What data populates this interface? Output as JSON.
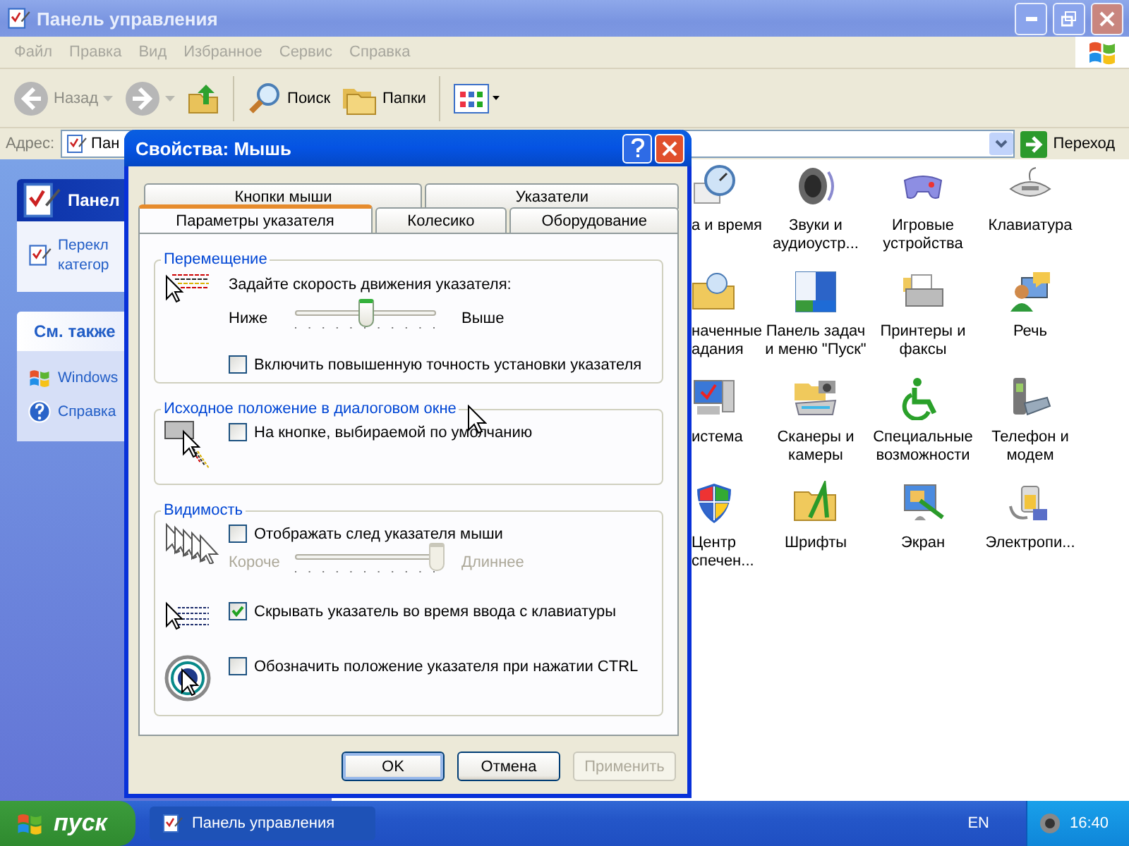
{
  "window": {
    "title": "Панель управления",
    "active": false
  },
  "menu": [
    "Файл",
    "Правка",
    "Вид",
    "Избранное",
    "Сервис",
    "Справка"
  ],
  "toolbar": [
    {
      "kind": "back",
      "label": "Назад",
      "disabled": true
    },
    {
      "kind": "forward",
      "disabled": true
    },
    {
      "kind": "up"
    },
    {
      "kind": "separator"
    },
    {
      "kind": "search",
      "label": "Поиск"
    },
    {
      "kind": "folders",
      "label": "Папки"
    },
    {
      "kind": "separator"
    },
    {
      "kind": "views"
    }
  ],
  "address": {
    "label": "Адрес:",
    "value": "Пан",
    "go": "Переход"
  },
  "sidebar": [
    {
      "kind": "primary",
      "title": "Панел",
      "links": [
        {
          "text": "Перекл\nкатегор"
        }
      ]
    },
    {
      "kind": "secondary",
      "title": "См. также",
      "links": [
        {
          "text": "Windows"
        },
        {
          "text": "Справка"
        }
      ]
    }
  ],
  "items": [
    {
      "label": "а и время"
    },
    {
      "label": "Звуки и\nаудиоустр..."
    },
    {
      "label": "Игровые\nустройства"
    },
    {
      "label": "Клавиатура"
    },
    {
      "label": "наченные\nадания"
    },
    {
      "label": "Панель задач\nи меню \"Пуск\""
    },
    {
      "label": "Принтеры и\nфаксы"
    },
    {
      "label": "Речь"
    },
    {
      "label": "истема"
    },
    {
      "label": "Сканеры и\nкамеры"
    },
    {
      "label": "Специальные\nвозможности"
    },
    {
      "label": "Телефон и\nмодем"
    },
    {
      "label": "Центр\nспечен..."
    },
    {
      "label": "Шрифты"
    },
    {
      "label": "Экран"
    },
    {
      "label": "Электропи..."
    }
  ],
  "dialog": {
    "title": "Свойства: Мышь",
    "tabs_back": [
      {
        "label": "Кнопки мыши",
        "selected": false
      },
      {
        "label": "Указатели",
        "selected": false
      }
    ],
    "tabs_front": [
      {
        "label": "Параметры указателя",
        "selected": true
      },
      {
        "label": "Колесико",
        "selected": false
      },
      {
        "label": "Оборудование",
        "selected": false
      }
    ],
    "groups": [
      {
        "title": "Перемещение",
        "blocks": [
          {
            "rows": [
              {
                "kind": "text",
                "text": "Задайте скорость движения указателя:"
              },
              {
                "kind": "slider",
                "min_label": "Ниже",
                "max_label": "Выше",
                "level": 0.5,
                "disabled": false
              },
              {
                "kind": "checkbox",
                "label": "Включить повышенную точность установки указателя",
                "checked": false
              }
            ]
          }
        ]
      },
      {
        "title": "Исходное положение в диалоговом окне",
        "blocks": [
          {
            "rows": [
              {
                "kind": "checkbox",
                "label": "На кнопке, выбираемой по умолчанию",
                "checked": false
              }
            ]
          }
        ]
      },
      {
        "title": "Видимость",
        "blocks": [
          {
            "rows": [
              {
                "kind": "checkbox",
                "label": "Отображать след указателя мыши",
                "checked": false
              },
              {
                "kind": "slider",
                "min_label": "Короче",
                "max_label": "Длиннее",
                "level": 1,
                "disabled": true
              }
            ]
          },
          {
            "rows": [
              {
                "kind": "checkbox",
                "label": "Скрывать указатель во время ввода с клавиатуры",
                "checked": true
              }
            ]
          },
          {
            "rows": [
              {
                "kind": "checkbox",
                "label": "Обозначить положение указателя при нажатии CTRL",
                "checked": false
              }
            ]
          }
        ]
      }
    ],
    "buttons": [
      {
        "label": "OK",
        "disabled": false,
        "default": true
      },
      {
        "label": "Отмена",
        "disabled": false,
        "default": false
      },
      {
        "label": "Применить",
        "disabled": true,
        "default": false
      }
    ]
  },
  "taskbar": {
    "start": "пуск",
    "tasks": [
      {
        "label": "Панель управления",
        "selected": false
      }
    ],
    "language": "EN",
    "clock": "16:40"
  }
}
